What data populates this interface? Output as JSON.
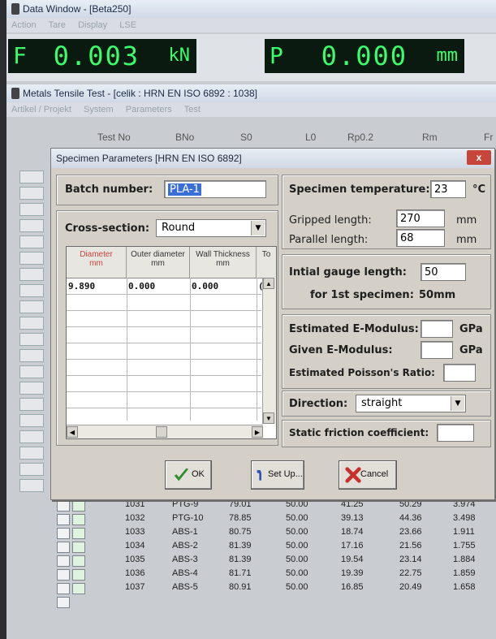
{
  "data_window": {
    "title": "Data Window - [Beta250]",
    "menu": [
      "Action",
      "Tare",
      "Display",
      "LSE"
    ],
    "force_display": {
      "label": "F",
      "value": "0.003",
      "unit": "kN"
    },
    "position_display": {
      "label": "P",
      "value": "0.000",
      "unit": "mm"
    }
  },
  "test_window": {
    "title": "Metals Tensile Test - [celik : HRN EN ISO 6892 : 1038]",
    "menu": [
      "Artikel / Projekt",
      "System",
      "Parameters",
      "Test"
    ],
    "columns": [
      "Test No",
      "BNo",
      "S0",
      "L0",
      "Rp0.2",
      "Rm",
      "Fr"
    ]
  },
  "table_rows": [
    {
      "test_no": "1031",
      "bno": "PTG-9",
      "s0": "79.01",
      "l0": "50.00",
      "rp": "41.25",
      "rm": "50.29",
      "fr": "3.974"
    },
    {
      "test_no": "1032",
      "bno": "PTG-10",
      "s0": "78.85",
      "l0": "50.00",
      "rp": "39.13",
      "rm": "44.36",
      "fr": "3.498"
    },
    {
      "test_no": "1033",
      "bno": "ABS-1",
      "s0": "80.75",
      "l0": "50.00",
      "rp": "18.74",
      "rm": "23.66",
      "fr": "1.911"
    },
    {
      "test_no": "1034",
      "bno": "ABS-2",
      "s0": "81.39",
      "l0": "50.00",
      "rp": "17.16",
      "rm": "21.56",
      "fr": "1.755"
    },
    {
      "test_no": "1035",
      "bno": "ABS-3",
      "s0": "81.39",
      "l0": "50.00",
      "rp": "19.54",
      "rm": "23.14",
      "fr": "1.884"
    },
    {
      "test_no": "1036",
      "bno": "ABS-4",
      "s0": "81.71",
      "l0": "50.00",
      "rp": "19.39",
      "rm": "22.75",
      "fr": "1.859"
    },
    {
      "test_no": "1037",
      "bno": "ABS-5",
      "s0": "80.91",
      "l0": "50.00",
      "rp": "16.85",
      "rm": "20.49",
      "fr": "1.658"
    }
  ],
  "dialog": {
    "title": "Specimen Parameters [HRN EN ISO 6892]",
    "close": "x",
    "batch_label": "Batch number:",
    "batch_value": "PLA-1",
    "cross_section_label": "Cross-section:",
    "cross_section_value": "Round",
    "grid_headers": [
      {
        "name": "Diameter",
        "unit": "mm"
      },
      {
        "name": "Outer diameter",
        "unit": "mm"
      },
      {
        "name": "Wall Thickness",
        "unit": "mm"
      },
      {
        "name": "To",
        "unit": ""
      }
    ],
    "grid_row": [
      "9.890",
      "0.000",
      "0.000",
      "("
    ],
    "temperature_label": "Specimen temperature:",
    "temperature_value": "23",
    "temperature_unit": "°C",
    "gripped_label": "Gripped length:",
    "gripped_value": "270",
    "gripped_unit": "mm",
    "parallel_label": "Parallel length:",
    "parallel_value": "68",
    "parallel_unit": "mm",
    "gauge_label": "Intial gauge length:",
    "gauge_value": "50",
    "first_specimen_label": "for 1st specimen:",
    "first_specimen_value": "50mm",
    "est_modulus_label": "Estimated E-Modulus:",
    "est_modulus_unit": "GPa",
    "given_modulus_label": "Given E-Modulus:",
    "given_modulus_unit": "GPa",
    "poisson_label": "Estimated Poisson's Ratio:",
    "direction_label": "Direction:",
    "direction_value": "straight",
    "friction_label": "Static friction coefficient:",
    "ok_label": "OK",
    "setup_label": "Set Up...",
    "cancel_label": "Cancel"
  }
}
